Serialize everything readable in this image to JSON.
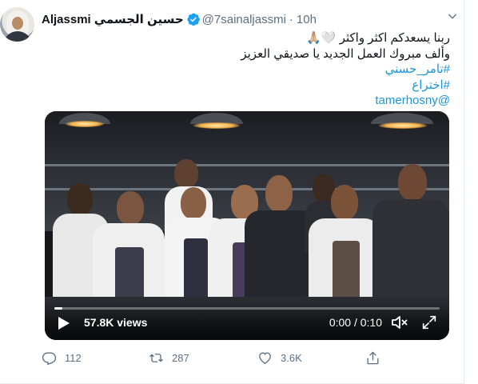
{
  "author": {
    "display_name": "Aljassmi",
    "display_name_ar": "حسين الجسمي",
    "handle": "@7sainaljassmi",
    "separator": "·",
    "time": "10h"
  },
  "tweet": {
    "line1_text": "ربنا يسعدكم اكثر واكثر",
    "line1_emoji": "🙏🏼🤍",
    "line2": "وألف مبروك العمل الجديد يا صديقي العزيز",
    "hashtag1": "#تامر_حسني",
    "hashtag2": "#اختراع",
    "mention": "@tamerhosny"
  },
  "video": {
    "views": "57.8K views",
    "timecode": "0:00 / 0:10",
    "progress": 0.02
  },
  "actions": {
    "reply_count": "112",
    "retweet_count": "287",
    "like_count": "3.6K"
  },
  "colors": {
    "link": "#1b95e0",
    "secondary_text": "#5b7083",
    "verified": "#1da1f2"
  }
}
